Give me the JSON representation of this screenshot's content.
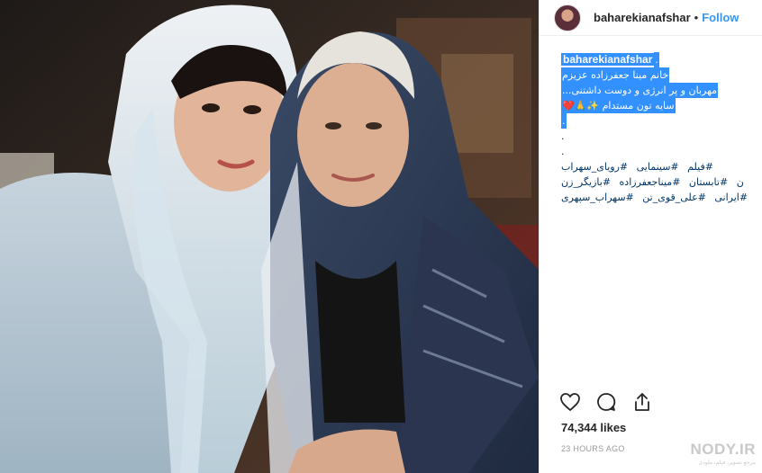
{
  "post": {
    "username": "baharekianafshar",
    "separator": "•",
    "follow_label": "Follow",
    "caption": {
      "username": "baharekianafshar",
      "trailing": ".",
      "lines": [
        "خانم مینا جعفرزاده عزیزم",
        "مهربان و پر انرژی و دوست داشتنی...",
        "سایه تون مستدام ✨🙏❤️",
        "."
      ],
      "dots": [
        ".",
        "."
      ],
      "hashtags_line1": [
        "#فیلم",
        "#سینمایی",
        "#رویای_سهراب"
      ],
      "hashtags_line2": [
        "#تابستان",
        "#میناجعفرزاده",
        "#بازیگر_زن"
      ],
      "hashtags_line3": [
        "#ایرانی",
        "#علی_قوی_تن",
        "#سهراب_سپهری"
      ],
      "overflow_char": "ن"
    },
    "likes": "74,344 likes",
    "time": "23 HOURS AGO"
  },
  "icons": {
    "like": "heart-icon",
    "comment": "comment-icon",
    "share": "share-icon"
  },
  "watermark": {
    "text": "NODY.IR",
    "sub": "مرجع تصویر، فیلم، ملودی"
  },
  "colors": {
    "accent": "#3897f0",
    "selection": "#3390ff",
    "text": "#262626",
    "muted": "#999999"
  }
}
